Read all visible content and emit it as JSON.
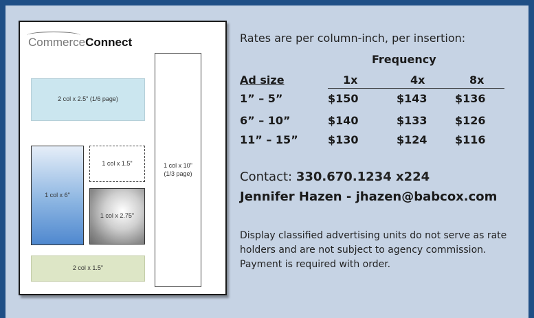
{
  "mockup": {
    "logo_light": "Commerce",
    "logo_bold": "Connect",
    "units": {
      "wide": "2 col x 2.5\" (1/6 page)",
      "tall_line1": "1 col x 10\"",
      "tall_line2": "(1/3 page)",
      "six": "1 col x 6\"",
      "one_five": "1 col x 1.5\"",
      "two_seven_five": "1 col x 2.75\"",
      "two_by_one_five": "2 col x 1.5\""
    }
  },
  "rates": {
    "intro": "Rates are per column-inch, per insertion:",
    "frequency_label": "Frequency",
    "columns": [
      "Ad size",
      "1x",
      "4x",
      "8x"
    ],
    "rows": [
      [
        "1” – 5”",
        "$150",
        "$143",
        "$136"
      ],
      [
        "6” – 10”",
        "$140",
        "$133",
        "$126"
      ],
      [
        "11” – 15”",
        "$130",
        "$124",
        "$116"
      ]
    ]
  },
  "contact": {
    "prefix": "Contact: ",
    "phone": "330.670.1234 x224",
    "person": "Jennifer Hazen - jhazen@babcox.com"
  },
  "disclaimer": "Display classified advertising units do not serve as rate holders and are not subject to agency commission. Payment is required with order.",
  "colors": {
    "frame": "#1f4f86",
    "panel": "#c6d3e4"
  }
}
